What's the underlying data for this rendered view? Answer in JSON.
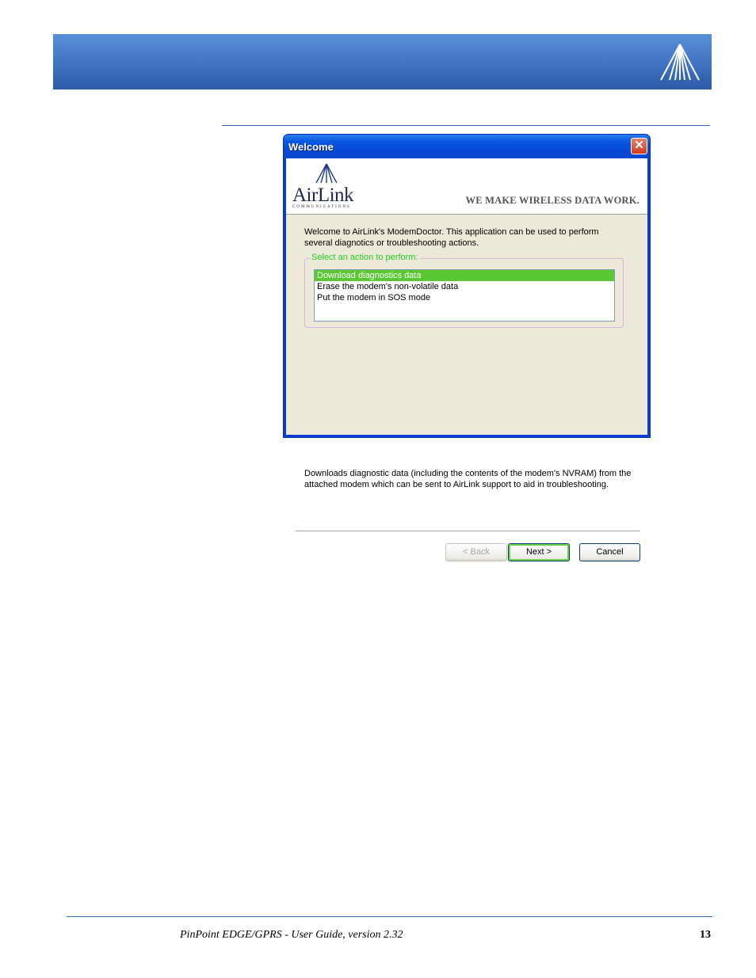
{
  "dialog": {
    "title": "Welcome",
    "close_glyph": "✕",
    "brand": {
      "name": "AirLink",
      "subtitle": "COMMUNICATIONS",
      "tagline": "WE MAKE WIRELESS DATA WORK."
    },
    "intro": "Welcome to AirLink's ModemDoctor. This application can be used to perform several diagnotics or troubleshooting actions.",
    "group_label": "Select an action to perform:",
    "actions": [
      "Download diagnostics data",
      "Erase the modem's non-volatile data",
      "Put the modem in SOS mode"
    ],
    "selected_action": "Download diagnostics data",
    "description": "Downloads diagnostic data (including the contents of the modem's NVRAM) from the attached modem which can be sent to AirLink support to aid in troubleshooting.",
    "buttons": {
      "back": "< Back",
      "next": "Next >",
      "cancel": "Cancel"
    }
  },
  "footer": {
    "doc_title": "PinPoint EDGE/GPRS - User Guide, version 2.32",
    "page_number": "13"
  },
  "icons": {
    "banner_logo": "airlink-triangle-icon",
    "close": "close-icon"
  }
}
